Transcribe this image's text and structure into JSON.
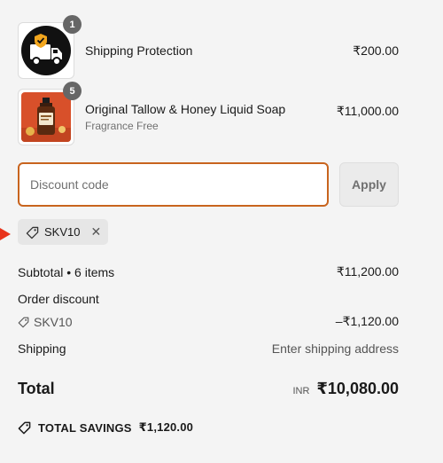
{
  "items": [
    {
      "title": "Shipping Protection",
      "subtitle": "",
      "price": "₹200.00",
      "quantity": "1",
      "thumbnail": "shipping-truck-shield-icon"
    },
    {
      "title": "Original Tallow & Honey Liquid Soap",
      "subtitle": "Fragrance Free",
      "price": "₹11,000.00",
      "quantity": "5",
      "thumbnail": "soap-bottle-image"
    }
  ],
  "discount": {
    "placeholder": "Discount code",
    "apply_label": "Apply",
    "applied_code": "SKV10"
  },
  "summary": {
    "subtotal_label": "Subtotal • 6 items",
    "subtotal_value": "₹11,200.00",
    "order_discount_label": "Order discount",
    "discount_code": "SKV10",
    "discount_value": "–₹1,120.00",
    "shipping_label": "Shipping",
    "shipping_value": "Enter shipping address",
    "total_label": "Total",
    "total_currency": "INR",
    "total_value": "₹10,080.00",
    "savings_label": "TOTAL SAVINGS",
    "savings_value": "₹1,120.00"
  },
  "colors": {
    "input_focus_border": "#c8641e",
    "annotation_arrow": "#e8341c",
    "shield_orange": "#f2a61e"
  }
}
